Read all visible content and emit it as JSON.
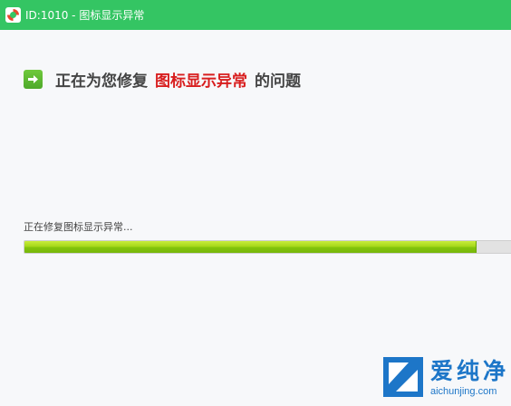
{
  "window": {
    "title": "ID:1010 - 图标显示异常",
    "logo_icon": "lifebuoy-icon"
  },
  "heading": {
    "icon": "arrow-right-icon",
    "prefix": "正在为您修复",
    "highlight": "图标显示异常",
    "suffix": "的问题"
  },
  "status": {
    "text": "正在修复图标显示异常..."
  },
  "progress": {
    "percent": 93
  },
  "watermark": {
    "title": "爱纯净",
    "url": "aichunjing.com"
  },
  "colors": {
    "titlebar": "#34c563",
    "highlight": "#d81e1e",
    "progress": "#a6d81b",
    "watermark": "#1d76c8"
  }
}
